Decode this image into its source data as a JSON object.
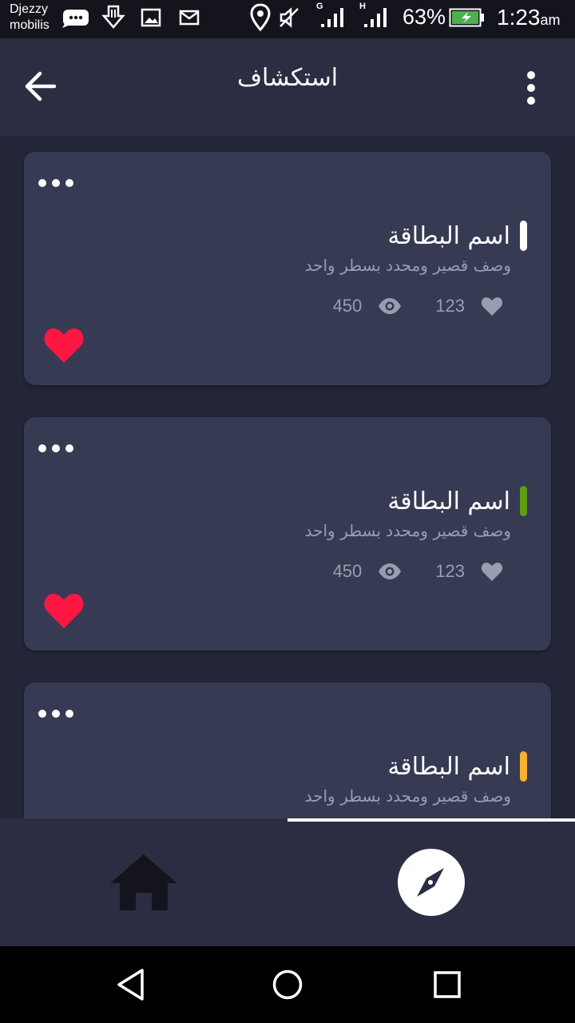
{
  "status_bar": {
    "carrier_line1": "Djezzy",
    "carrier_line2": "mobilis",
    "signal1_label": "G",
    "signal2_label": "H",
    "battery_percent": "63%",
    "time": "1:23",
    "time_suffix": "am",
    "icons": [
      "chat-bubble-icon",
      "download-icon",
      "image-icon",
      "mail-icon",
      "location-icon",
      "mute-icon",
      "signal-icon",
      "signal-icon",
      "battery-charging-icon"
    ]
  },
  "app_bar": {
    "title": "استكشاف",
    "back_icon": "arrow-back-icon",
    "menu_icon": "more-vert-icon"
  },
  "cards": [
    {
      "title": "اسم البطاقة",
      "description": "وصف قصير ومحدد بسطر واحد",
      "views": "450",
      "likes": "123",
      "accent_color": "#ffffff",
      "favorited": true
    },
    {
      "title": "اسم البطاقة",
      "description": "وصف قصير ومحدد بسطر واحد",
      "views": "450",
      "likes": "123",
      "accent_color": "#5f9e12",
      "favorited": true
    },
    {
      "title": "اسم البطاقة",
      "description": "وصف قصير ومحدد بسطر واحد",
      "accent_color": "#f7b22d"
    }
  ],
  "bottom_nav": {
    "tabs": [
      {
        "name": "home",
        "icon": "home-icon",
        "active": false
      },
      {
        "name": "explore",
        "icon": "compass-icon",
        "active": true
      }
    ]
  },
  "system_nav": {
    "icons": [
      "back-triangle-icon",
      "home-circle-icon",
      "recents-square-icon"
    ]
  },
  "colors": {
    "background": "#232638",
    "card": "#373a53",
    "app_bar": "#2b2e42",
    "heart": "#ff1744",
    "muted_text": "#9a9db0"
  }
}
